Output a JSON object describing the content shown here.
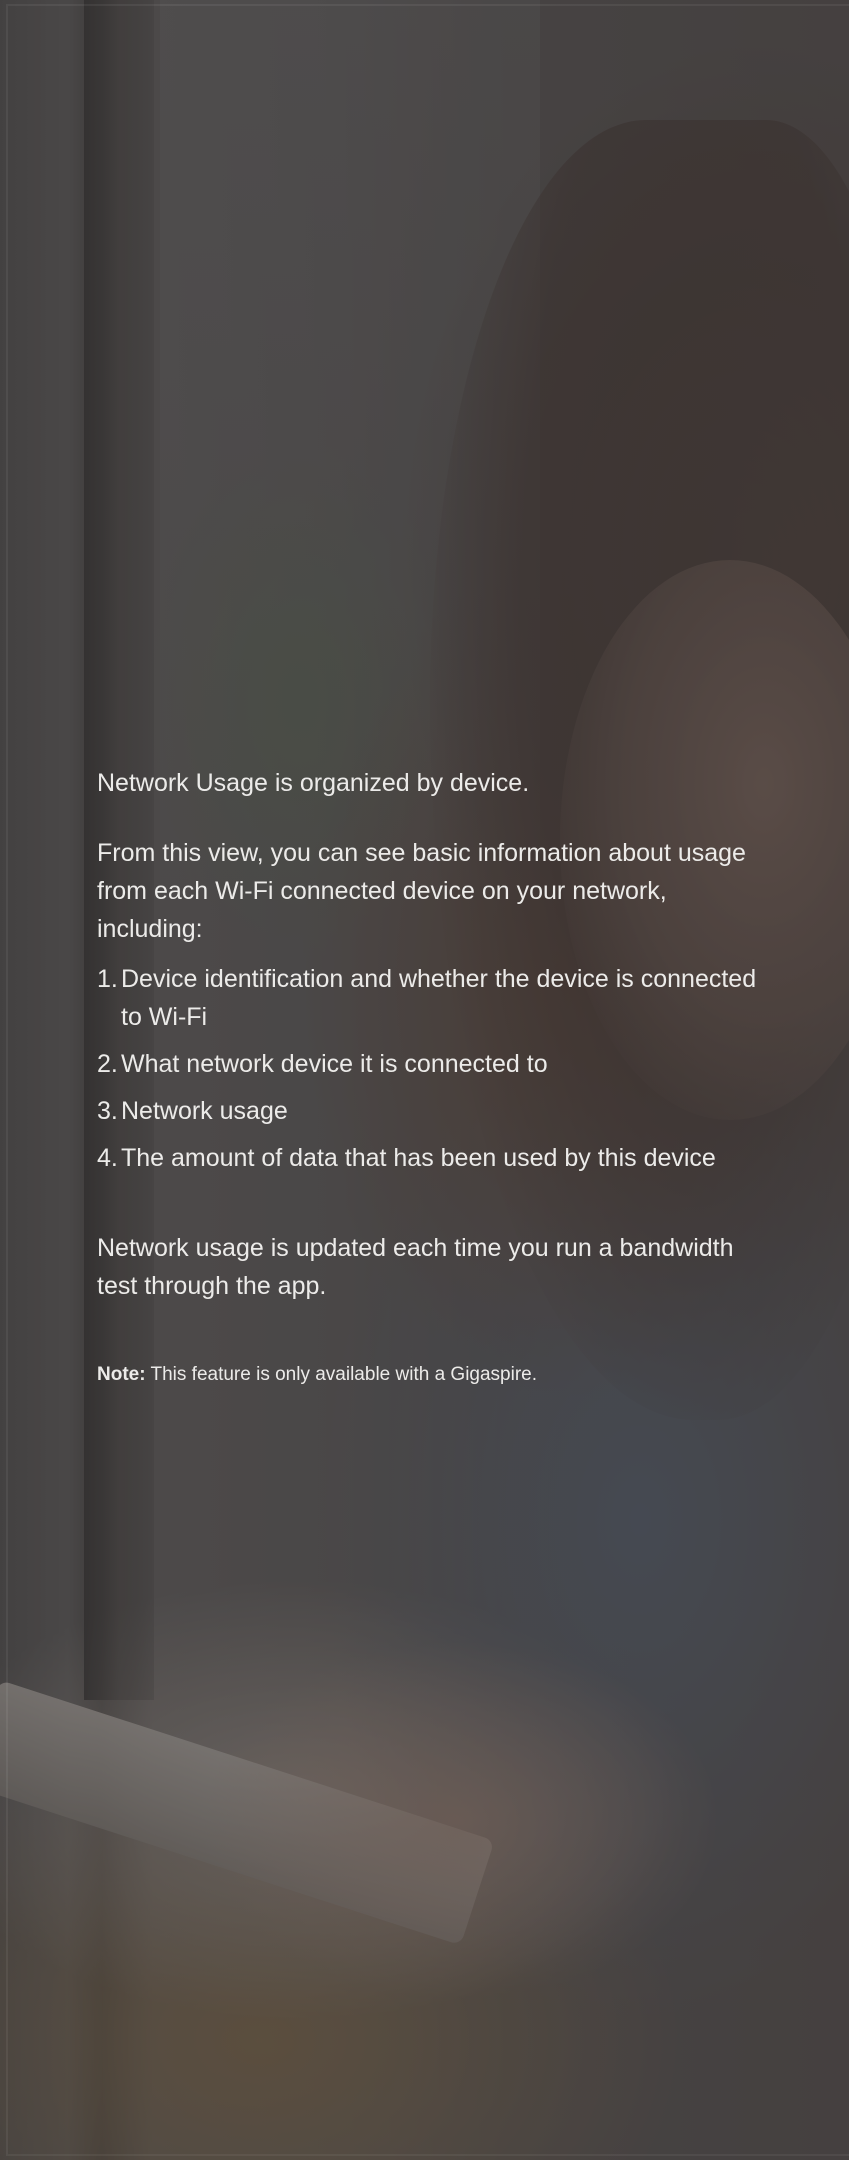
{
  "content": {
    "intro": "Network Usage is organized by device.",
    "view_text": "From this view, you can see basic information about usage from each Wi-Fi connected device on your network, including:",
    "items": [
      {
        "num": "1.",
        "text": "Device identification and whether the device is connected to Wi-Fi"
      },
      {
        "num": "2.",
        "text": "What network device it is connected to"
      },
      {
        "num": "3.",
        "text": "Network usage"
      },
      {
        "num": "4.",
        "text": "The amount of data that has been used by this device"
      }
    ],
    "update_text": "Network usage is updated each time you run a bandwidth test through the app.",
    "note_label": "Note:",
    "note_text": " This feature is only available with a Gigaspire."
  }
}
